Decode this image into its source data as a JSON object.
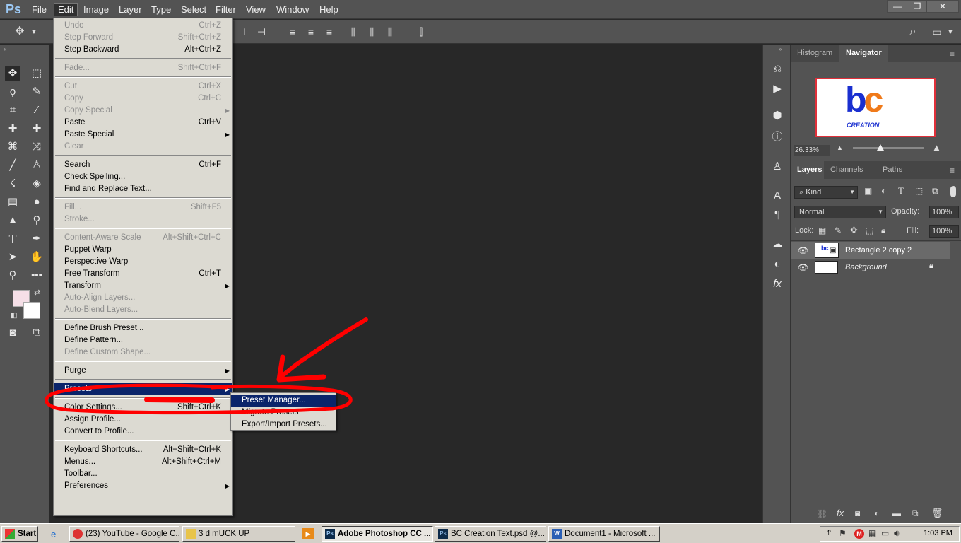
{
  "app": {
    "logo": "Ps"
  },
  "menubar": {
    "items": [
      "File",
      "Edit",
      "Image",
      "Layer",
      "Type",
      "Select",
      "Filter",
      "View",
      "Window",
      "Help"
    ],
    "active": "Edit"
  },
  "window_controls": {
    "minimize": "—",
    "restore": "❐",
    "close": "✕"
  },
  "edit_menu": {
    "groups": [
      [
        {
          "label": "Undo",
          "shortcut": "Ctrl+Z",
          "disabled": true
        },
        {
          "label": "Step Forward",
          "shortcut": "Shift+Ctrl+Z",
          "disabled": true
        },
        {
          "label": "Step Backward",
          "shortcut": "Alt+Ctrl+Z",
          "disabled": false
        }
      ],
      [
        {
          "label": "Fade...",
          "shortcut": "Shift+Ctrl+F",
          "disabled": true
        }
      ],
      [
        {
          "label": "Cut",
          "shortcut": "Ctrl+X",
          "disabled": true
        },
        {
          "label": "Copy",
          "shortcut": "Ctrl+C",
          "disabled": true
        },
        {
          "label": "Copy Special",
          "shortcut": "",
          "disabled": true,
          "submenu": true
        },
        {
          "label": "Paste",
          "shortcut": "Ctrl+V",
          "disabled": false
        },
        {
          "label": "Paste Special",
          "shortcut": "",
          "disabled": false,
          "submenu": true
        },
        {
          "label": "Clear",
          "shortcut": "",
          "disabled": true
        }
      ],
      [
        {
          "label": "Search",
          "shortcut": "Ctrl+F",
          "disabled": false
        },
        {
          "label": "Check Spelling...",
          "shortcut": "",
          "disabled": false
        },
        {
          "label": "Find and Replace Text...",
          "shortcut": "",
          "disabled": false
        }
      ],
      [
        {
          "label": "Fill...",
          "shortcut": "Shift+F5",
          "disabled": true
        },
        {
          "label": "Stroke...",
          "shortcut": "",
          "disabled": true
        }
      ],
      [
        {
          "label": "Content-Aware Scale",
          "shortcut": "Alt+Shift+Ctrl+C",
          "disabled": true
        },
        {
          "label": "Puppet Warp",
          "shortcut": "",
          "disabled": false
        },
        {
          "label": "Perspective Warp",
          "shortcut": "",
          "disabled": false
        },
        {
          "label": "Free Transform",
          "shortcut": "Ctrl+T",
          "disabled": false
        },
        {
          "label": "Transform",
          "shortcut": "",
          "disabled": false,
          "submenu": true
        },
        {
          "label": "Auto-Align Layers...",
          "shortcut": "",
          "disabled": true
        },
        {
          "label": "Auto-Blend Layers...",
          "shortcut": "",
          "disabled": true
        }
      ],
      [
        {
          "label": "Define Brush Preset...",
          "shortcut": "",
          "disabled": false
        },
        {
          "label": "Define Pattern...",
          "shortcut": "",
          "disabled": false
        },
        {
          "label": "Define Custom Shape...",
          "shortcut": "",
          "disabled": true
        }
      ],
      [
        {
          "label": "Purge",
          "shortcut": "",
          "disabled": false,
          "submenu": true
        }
      ],
      [
        {
          "label": "Presets",
          "shortcut": "",
          "disabled": false,
          "submenu": true,
          "highlighted": true
        }
      ],
      [
        {
          "label": "Color Settings...",
          "shortcut": "Shift+Ctrl+K",
          "disabled": false
        },
        {
          "label": "Assign Profile...",
          "shortcut": "",
          "disabled": false
        },
        {
          "label": "Convert to Profile...",
          "shortcut": "",
          "disabled": false
        }
      ],
      [
        {
          "label": "Keyboard Shortcuts...",
          "shortcut": "Alt+Shift+Ctrl+K",
          "disabled": false
        },
        {
          "label": "Menus...",
          "shortcut": "Alt+Shift+Ctrl+M",
          "disabled": false
        },
        {
          "label": "Toolbar...",
          "shortcut": "",
          "disabled": false
        },
        {
          "label": "Preferences",
          "shortcut": "",
          "disabled": false,
          "submenu": true
        }
      ]
    ]
  },
  "presets_submenu": {
    "items": [
      {
        "label": "Preset Manager...",
        "highlighted": true
      },
      {
        "label": "Migrate Presets",
        "highlighted": false
      },
      {
        "label": "Export/Import Presets...",
        "highlighted": false
      }
    ]
  },
  "panels": {
    "top_tabs": [
      "Histogram",
      "Navigator"
    ],
    "top_active": "Navigator",
    "navigator": {
      "zoom": "26.33%",
      "thumb_logo": "bc",
      "thumb_caption": "CREATION"
    },
    "layer_tabs": [
      "Layers",
      "Channels",
      "Paths"
    ],
    "layer_active": "Layers",
    "filter_kind": "Kind",
    "blend_mode": "Normal",
    "opacity_label": "Opacity:",
    "opacity": "100%",
    "lock_label": "Lock:",
    "fill_label": "Fill:",
    "fill": "100%",
    "layers": [
      {
        "name": "Rectangle 2 copy 2",
        "selected": true,
        "locked": false
      },
      {
        "name": "Background",
        "selected": false,
        "locked": true
      }
    ]
  },
  "taskbar": {
    "start": "Start",
    "items": [
      {
        "label": "(23) YouTube - Google C...",
        "active": false
      },
      {
        "label": "3 d mUCK UP",
        "active": false
      },
      {
        "label": "Adobe Photoshop CC ...",
        "active": true
      },
      {
        "label": "BC Creation  Text.psd @...",
        "active": false
      },
      {
        "label": "Document1 - Microsoft ...",
        "active": false
      }
    ],
    "clock": "1:03 PM"
  },
  "colors": {
    "menu_bg": "#dcdad2",
    "highlight": "#0a246a",
    "annotation": "#ff0000",
    "foreground_swatch": "#f5dfe7",
    "background_swatch": "#ffffff"
  }
}
